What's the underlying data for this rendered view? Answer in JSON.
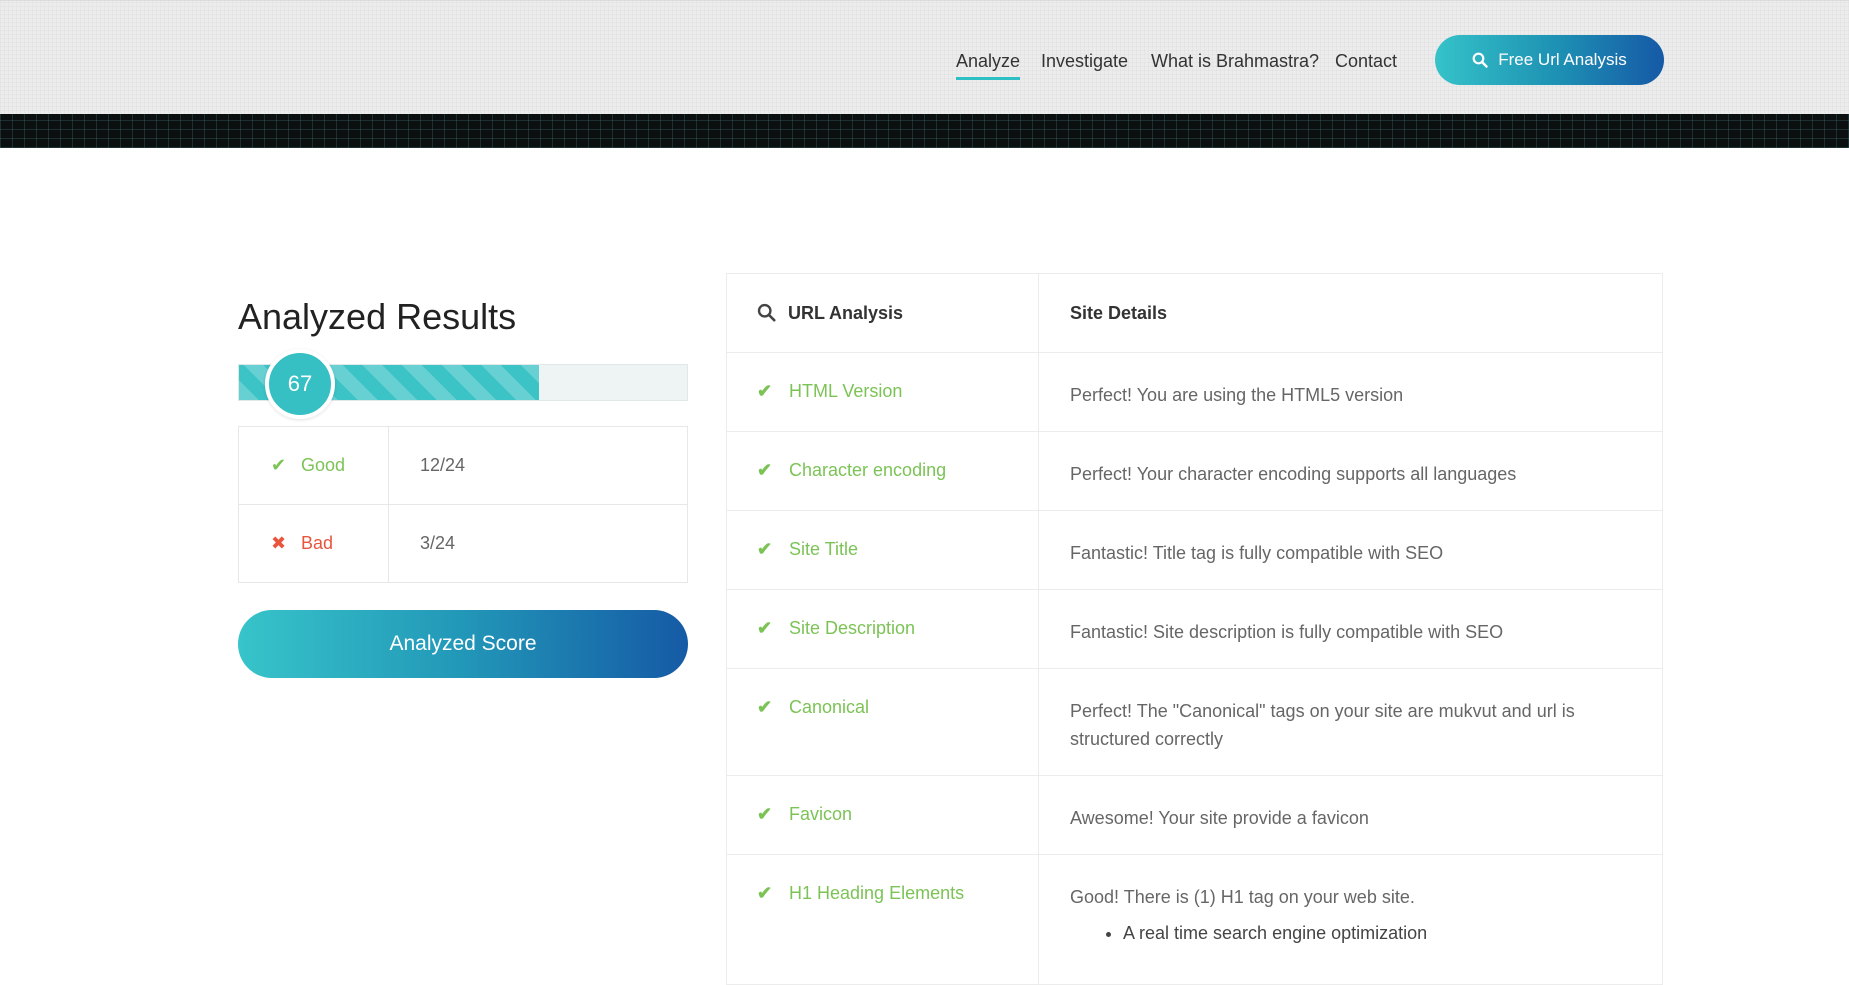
{
  "nav": {
    "items": [
      {
        "label": "Analyze",
        "active": true
      },
      {
        "label": "Investigate",
        "active": false
      },
      {
        "label": "What is Brahmastra?",
        "active": false
      },
      {
        "label": "Contact",
        "active": false
      }
    ],
    "cta_label": "Free Url Analysis",
    "cta_icon": "search-icon"
  },
  "results": {
    "title": "Analyzed Results",
    "score": "67",
    "progress_percent": 67,
    "good_label": "Good",
    "good_value": "12/24",
    "bad_label": "Bad",
    "bad_value": "3/24",
    "button_label": "Analyzed Score"
  },
  "analysis": {
    "col1_header": "URL Analysis",
    "col2_header": "Site Details",
    "rows": [
      {
        "name": "HTML Version",
        "detail": "Perfect! You are using the HTML5 version"
      },
      {
        "name": "Character encoding",
        "detail": "Perfect! Your character encoding supports all languages"
      },
      {
        "name": "Site Title",
        "detail": "Fantastic! Title tag is fully compatible with SEO"
      },
      {
        "name": "Site Description",
        "detail": "Fantastic! Site description is fully compatible with SEO"
      },
      {
        "name": "Canonical",
        "detail": "Perfect! The \"Canonical\" tags on your site are mukvut and url is structured correctly"
      },
      {
        "name": "Favicon",
        "detail": "Awesome! Your site provide a favicon"
      },
      {
        "name": "H1 Heading Elements",
        "detail": "Good! There is (1) H1 tag on your web site.",
        "bullets": [
          "A real time search engine optimization"
        ]
      }
    ]
  },
  "colors": {
    "accent": "#35c3c9",
    "brand_dark": "#1659a6",
    "good": "#7cc356",
    "bad": "#e7563d"
  }
}
